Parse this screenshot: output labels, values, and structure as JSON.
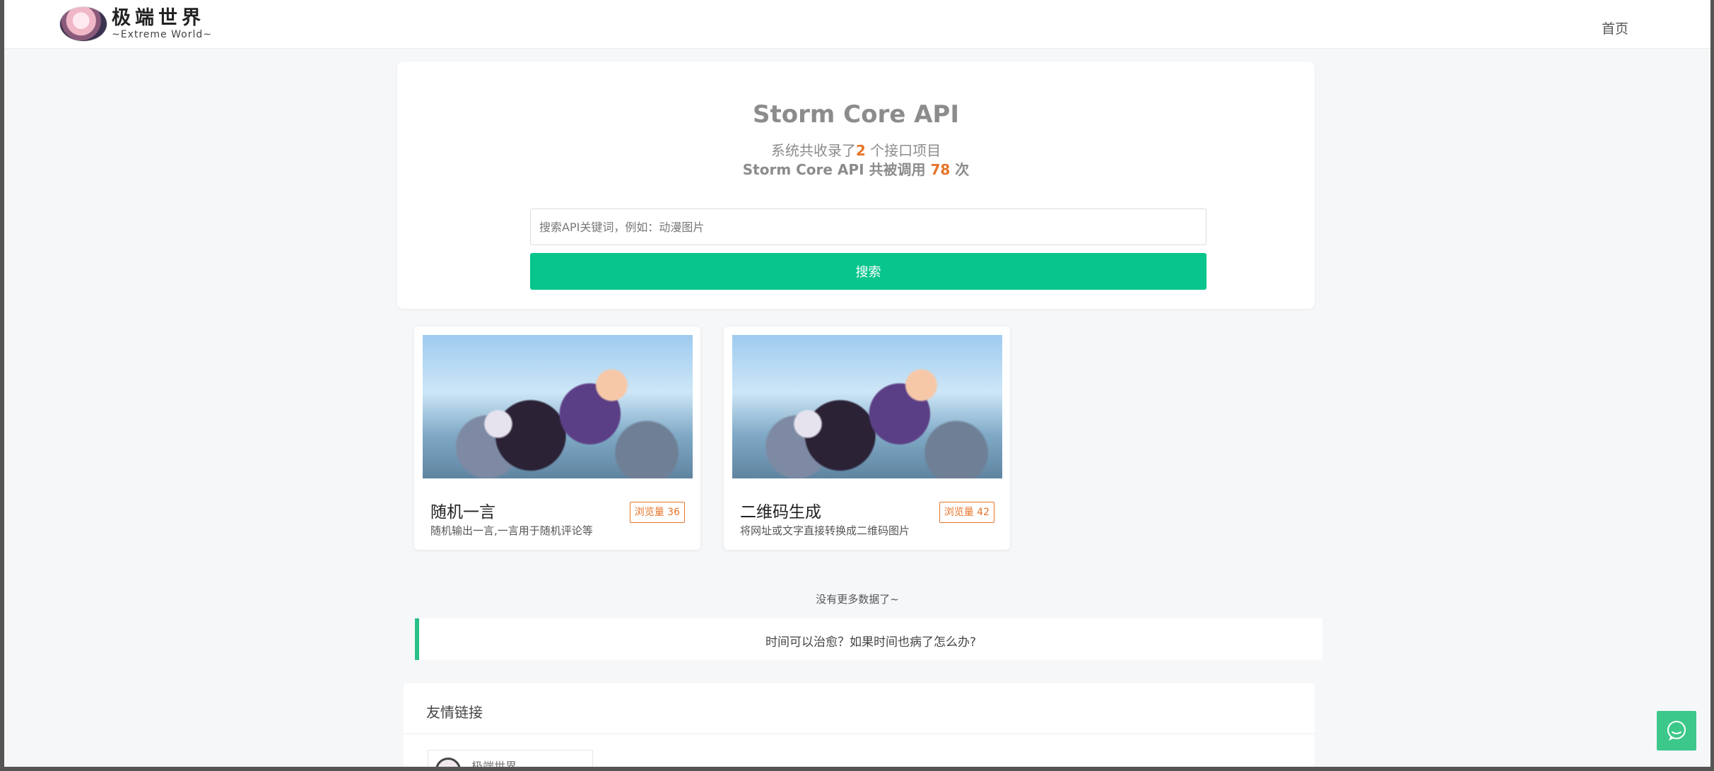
{
  "nav": {
    "logo_title": "极端世界",
    "logo_subtitle": "~Extreme World~",
    "home_label": "首页"
  },
  "hero": {
    "title": "Storm Core API",
    "line1_prefix": "系统共收录了",
    "line1_count": "2",
    "line1_suffix": " 个接口项目",
    "line2_prefix": "Storm Core API 共被调用 ",
    "line2_count": "78",
    "line2_suffix": " 次",
    "search_placeholder": "搜索API关键词，例如：动漫图片",
    "search_value": "",
    "search_button": "搜索"
  },
  "apis": [
    {
      "name": "随机一言",
      "desc": "随机输出一言,一言用于随机评论等",
      "views": "浏览量 36"
    },
    {
      "name": "二维码生成",
      "desc": "将网址或文字直接转换成二维码图片",
      "views": "浏览量 42"
    }
  ],
  "no_more": "没有更多数据了~",
  "quote": "时间可以治愈？如果时间也病了怎么办?",
  "links": {
    "title": "友情链接",
    "items": [
      {
        "name": "极端世界"
      }
    ]
  },
  "colors": {
    "accent_green": "#07c58d",
    "count_orange": "#e6742a",
    "page_bg": "#f6f7f9"
  }
}
